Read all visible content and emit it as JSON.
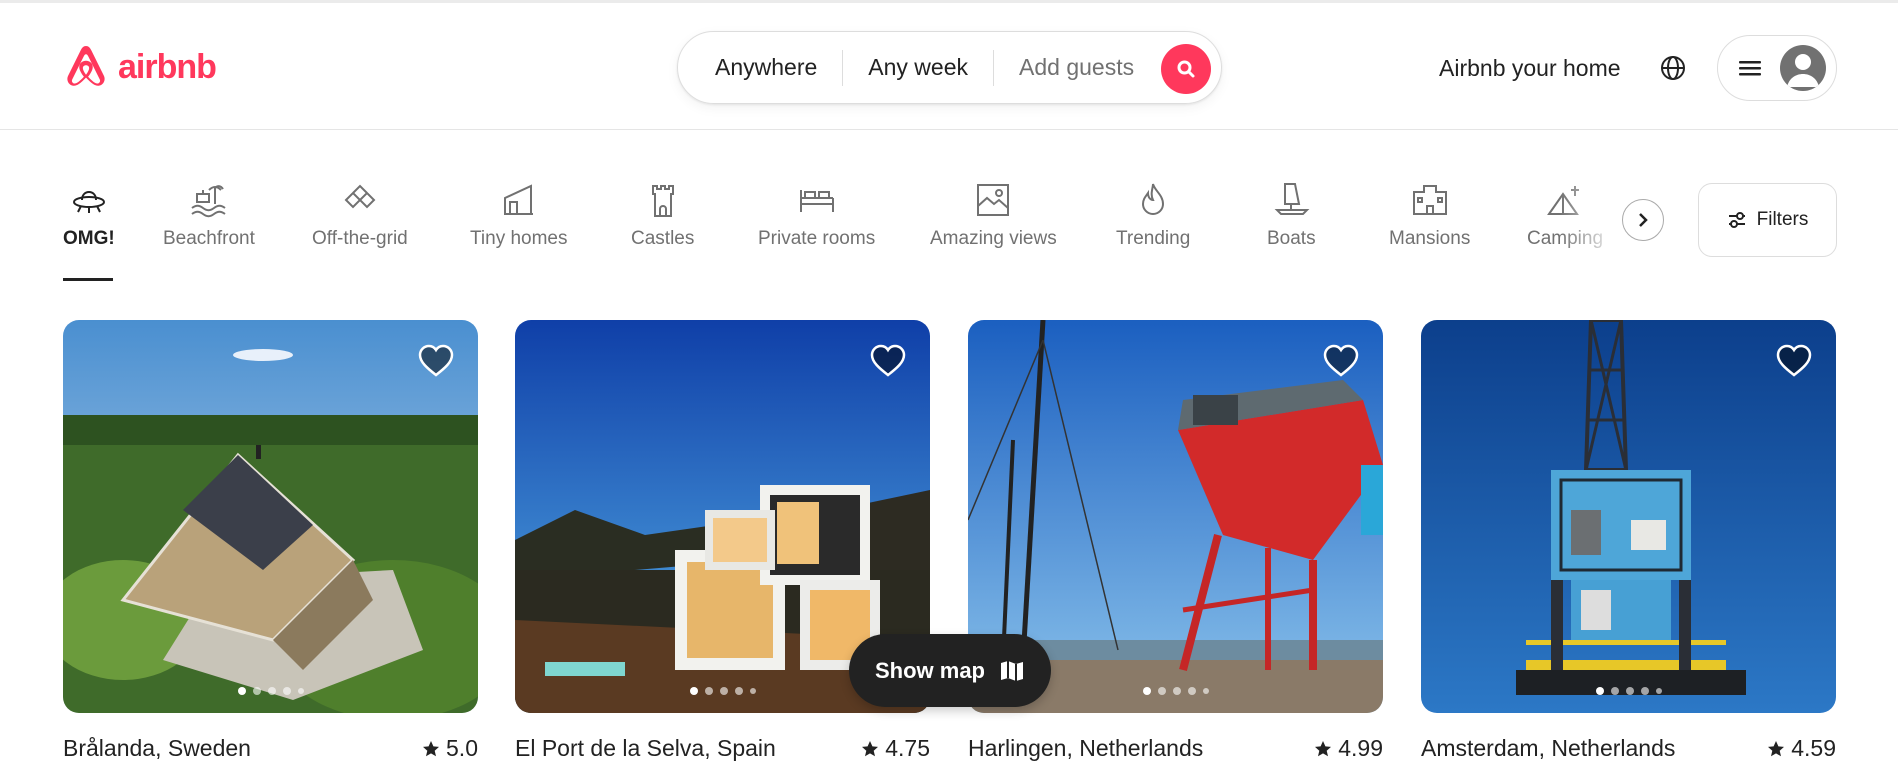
{
  "header": {
    "logo_text": "airbnb",
    "brand_color": "#ff385c",
    "search": {
      "where": "Anywhere",
      "when": "Any week",
      "who": "Add guests"
    },
    "host_link": "Airbnb your home"
  },
  "categories": {
    "active": "OMG!",
    "items": [
      {
        "label": "OMG!",
        "icon": "ufo-icon"
      },
      {
        "label": "Beachfront",
        "icon": "beach-icon"
      },
      {
        "label": "Off-the-grid",
        "icon": "off-grid-icon"
      },
      {
        "label": "Tiny homes",
        "icon": "tiny-home-icon"
      },
      {
        "label": "Castles",
        "icon": "castle-icon"
      },
      {
        "label": "Private rooms",
        "icon": "bed-icon"
      },
      {
        "label": "Amazing views",
        "icon": "view-icon"
      },
      {
        "label": "Trending",
        "icon": "flame-icon"
      },
      {
        "label": "Boats",
        "icon": "boat-icon"
      },
      {
        "label": "Mansions",
        "icon": "mansion-icon"
      },
      {
        "label": "Camping",
        "icon": "tent-icon"
      }
    ],
    "filters_label": "Filters"
  },
  "listings": [
    {
      "location": "Brålanda, Sweden",
      "rating": "5.0"
    },
    {
      "location": "El Port de la Selva, Spain",
      "rating": "4.75"
    },
    {
      "location": "Harlingen, Netherlands",
      "rating": "4.99"
    },
    {
      "location": "Amsterdam, Netherlands",
      "rating": "4.59"
    }
  ],
  "map_button": "Show map"
}
